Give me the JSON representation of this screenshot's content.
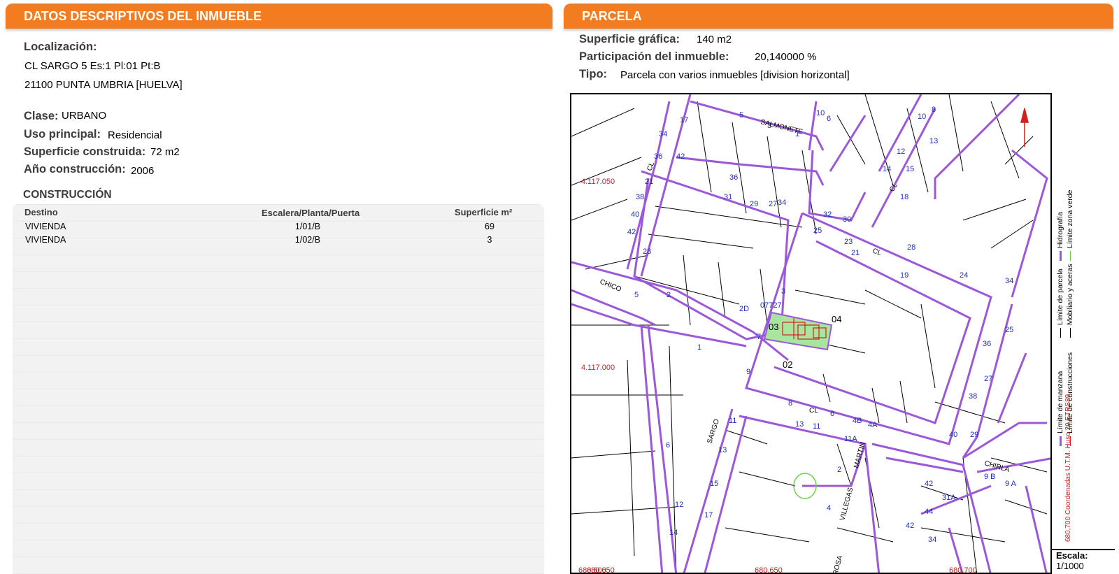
{
  "left": {
    "header": "DATOS DESCRIPTIVOS DEL INMUEBLE",
    "localizacion_label": "Localización:",
    "address_line1": "CL SARGO 5 Es:1 Pl:01 Pt:B",
    "address_line2": "21100 PUNTA UMBRIA [HUELVA]",
    "clase_label": "Clase:",
    "clase_value": "URBANO",
    "uso_label": "Uso principal:",
    "uso_value": "Residencial",
    "superficie_label": "Superficie construida:",
    "superficie_value": "72 m2",
    "anio_label": "Año construcción:",
    "anio_value": "2006",
    "construccion_title": "CONSTRUCCIÓN",
    "table": {
      "headers": [
        "Destino",
        "Escalera/Planta/Puerta",
        "Superficie m²"
      ],
      "rows": [
        [
          "VIVIENDA",
          "1/01/B",
          "69"
        ],
        [
          "VIVIENDA",
          "1/02/B",
          "3"
        ]
      ]
    }
  },
  "right": {
    "header": "PARCELA",
    "sup_grafica_label": "Superficie gráfica:",
    "sup_grafica_value": "140 m2",
    "participacion_label": "Participación del inmueble:",
    "participacion_value": "20,140000 %",
    "tipo_label": "Tipo:",
    "tipo_value": "Parcela con varios inmuebles [division horizontal]"
  },
  "map": {
    "coord_y1": "4.117.050",
    "coord_y2": "4.117.000",
    "coord_x1": "680.600",
    "coord_x1_overlap": "680.650",
    "coord_x2": "680.650",
    "coord_x3": "680.700",
    "parcel_ref": "07727",
    "parcel_codes": [
      "03",
      "04",
      "02"
    ],
    "street_names": [
      "SALMONETE",
      "CL",
      "CHICO",
      "SARGO",
      "MARTIN",
      "VILLEGAS",
      "CHIRLA",
      "ROSA"
    ],
    "legend": {
      "col1": [
        "Límite de manzana",
        "Límite de construcciones"
      ],
      "col2": [
        "Límite de parcela",
        "Mobiliario y aceras"
      ],
      "col3": [
        "Hidrografía",
        "Límite zona verde"
      ],
      "coords_note": "680,700 Coordenadas U.T.M. Huso 29 ETRS89"
    },
    "scale_label": "Escala:",
    "scale_value": "1/1000",
    "colors": {
      "accent": "#f47c20",
      "parcel_line": "#9b59d9",
      "number_blue": "#1f2fb8",
      "coord_red": "#d02020",
      "parcel_fill": "#a8e6a0"
    }
  }
}
